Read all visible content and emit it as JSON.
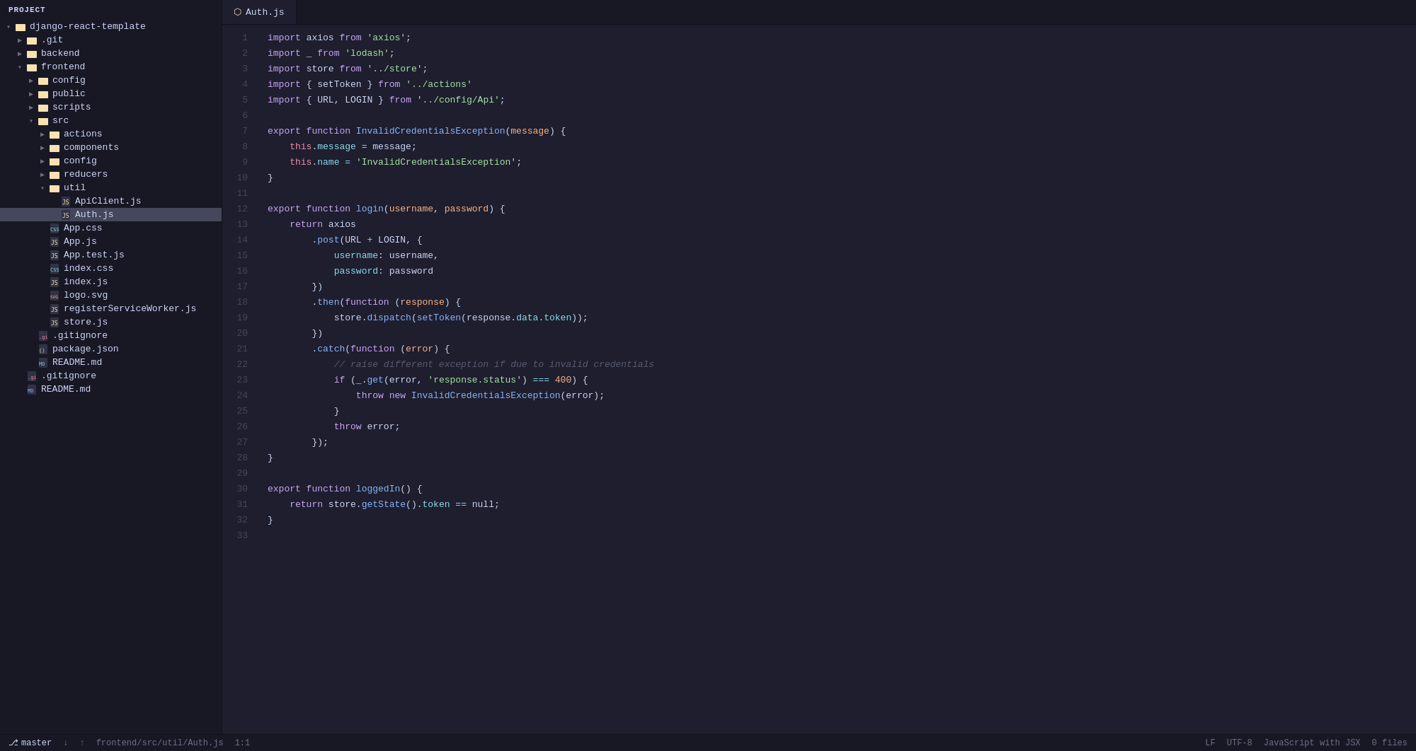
{
  "sidebar": {
    "header": "Project",
    "tree": [
      {
        "id": "root",
        "indent": 0,
        "arrow": "▾",
        "iconType": "folder-open",
        "label": "django-react-template",
        "type": "folder"
      },
      {
        "id": "git",
        "indent": 1,
        "arrow": "▶",
        "iconType": "folder",
        "label": ".git",
        "type": "folder"
      },
      {
        "id": "backend",
        "indent": 1,
        "arrow": "▶",
        "iconType": "folder",
        "label": "backend",
        "type": "folder"
      },
      {
        "id": "frontend",
        "indent": 1,
        "arrow": "▾",
        "iconType": "folder-open",
        "label": "frontend",
        "type": "folder"
      },
      {
        "id": "config",
        "indent": 2,
        "arrow": "▶",
        "iconType": "folder",
        "label": "config",
        "type": "folder"
      },
      {
        "id": "public",
        "indent": 2,
        "arrow": "▶",
        "iconType": "folder",
        "label": "public",
        "type": "folder"
      },
      {
        "id": "scripts",
        "indent": 2,
        "arrow": "▶",
        "iconType": "folder",
        "label": "scripts",
        "type": "folder"
      },
      {
        "id": "src",
        "indent": 2,
        "arrow": "▾",
        "iconType": "folder-open",
        "label": "src",
        "type": "folder"
      },
      {
        "id": "actions",
        "indent": 3,
        "arrow": "▶",
        "iconType": "folder",
        "label": "actions",
        "type": "folder"
      },
      {
        "id": "components",
        "indent": 3,
        "arrow": "▶",
        "iconType": "folder",
        "label": "components",
        "type": "folder"
      },
      {
        "id": "config2",
        "indent": 3,
        "arrow": "▶",
        "iconType": "folder",
        "label": "config",
        "type": "folder"
      },
      {
        "id": "reducers",
        "indent": 3,
        "arrow": "▶",
        "iconType": "folder",
        "label": "reducers",
        "type": "folder"
      },
      {
        "id": "util",
        "indent": 3,
        "arrow": "▾",
        "iconType": "folder-open",
        "label": "util",
        "type": "folder"
      },
      {
        "id": "apiclient",
        "indent": 4,
        "arrow": "",
        "iconType": "file-js",
        "label": "ApiClient.js",
        "type": "file"
      },
      {
        "id": "auth",
        "indent": 4,
        "arrow": "",
        "iconType": "file-js",
        "label": "Auth.js",
        "type": "file",
        "active": true
      },
      {
        "id": "appcss",
        "indent": 3,
        "arrow": "",
        "iconType": "file-css",
        "label": "App.css",
        "type": "file"
      },
      {
        "id": "appjs",
        "indent": 3,
        "arrow": "",
        "iconType": "file-js",
        "label": "App.js",
        "type": "file"
      },
      {
        "id": "apptestjs",
        "indent": 3,
        "arrow": "",
        "iconType": "file-js",
        "label": "App.test.js",
        "type": "file"
      },
      {
        "id": "indexcss",
        "indent": 3,
        "arrow": "",
        "iconType": "file-css",
        "label": "index.css",
        "type": "file"
      },
      {
        "id": "indexjs",
        "indent": 3,
        "arrow": "",
        "iconType": "file-js",
        "label": "index.js",
        "type": "file"
      },
      {
        "id": "logosvg",
        "indent": 3,
        "arrow": "",
        "iconType": "file-svg",
        "label": "logo.svg",
        "type": "file"
      },
      {
        "id": "registerServiceWorker",
        "indent": 3,
        "arrow": "",
        "iconType": "file-js",
        "label": "registerServiceWorker.js",
        "type": "file"
      },
      {
        "id": "storejs",
        "indent": 3,
        "arrow": "",
        "iconType": "file-js",
        "label": "store.js",
        "type": "file"
      },
      {
        "id": "gitignore2",
        "indent": 2,
        "arrow": "",
        "iconType": "file-git",
        "label": ".gitignore",
        "type": "file"
      },
      {
        "id": "packagejson",
        "indent": 2,
        "arrow": "",
        "iconType": "file-json",
        "label": "package.json",
        "type": "file"
      },
      {
        "id": "readmemd2",
        "indent": 2,
        "arrow": "",
        "iconType": "file-md",
        "label": "README.md",
        "type": "file"
      },
      {
        "id": "gitignore1",
        "indent": 1,
        "arrow": "",
        "iconType": "file-git",
        "label": ".gitignore",
        "type": "file"
      },
      {
        "id": "readmemd1",
        "indent": 1,
        "arrow": "",
        "iconType": "file-md",
        "label": "README.md",
        "type": "file"
      }
    ]
  },
  "editor": {
    "tab": {
      "icon": "js",
      "label": "Auth.js",
      "active": true
    }
  },
  "statusbar": {
    "filepath": "frontend/src/util/Auth.js",
    "position": "1:1",
    "encoding": "UTF-8",
    "language": "JavaScript with JSX",
    "branch": "master",
    "arrow_down": "↓",
    "arrow_up": "↑",
    "files": "0 files"
  }
}
